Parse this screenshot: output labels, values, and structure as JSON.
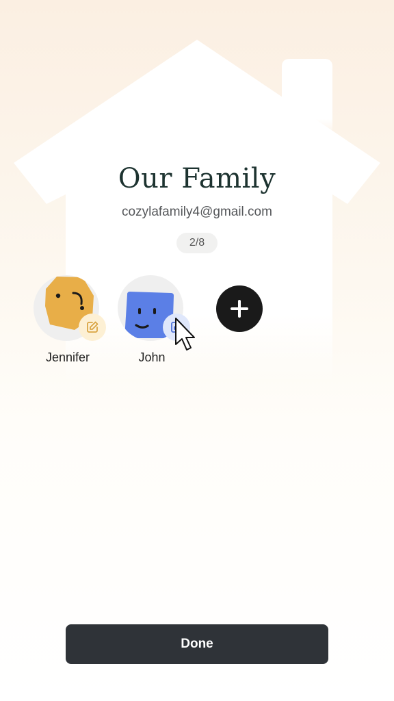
{
  "header": {
    "title": "Our Family",
    "email": "cozylafamily4@gmail.com",
    "member_count": "2/8"
  },
  "members": [
    {
      "name": "Jennifer",
      "avatar_color": "#e8ae48",
      "badge_color": "#fdf0d4",
      "badge_icon": "edit-icon"
    },
    {
      "name": "John",
      "avatar_color": "#5b7fe6",
      "badge_color": "#dfe7fb",
      "badge_icon": "edit-icon"
    }
  ],
  "actions": {
    "add_icon": "plus-icon",
    "done_label": "Done"
  },
  "colors": {
    "title": "#1d3330",
    "done_button": "#2f3338",
    "add_button": "#1a1a1a",
    "house": "#ffffff"
  }
}
